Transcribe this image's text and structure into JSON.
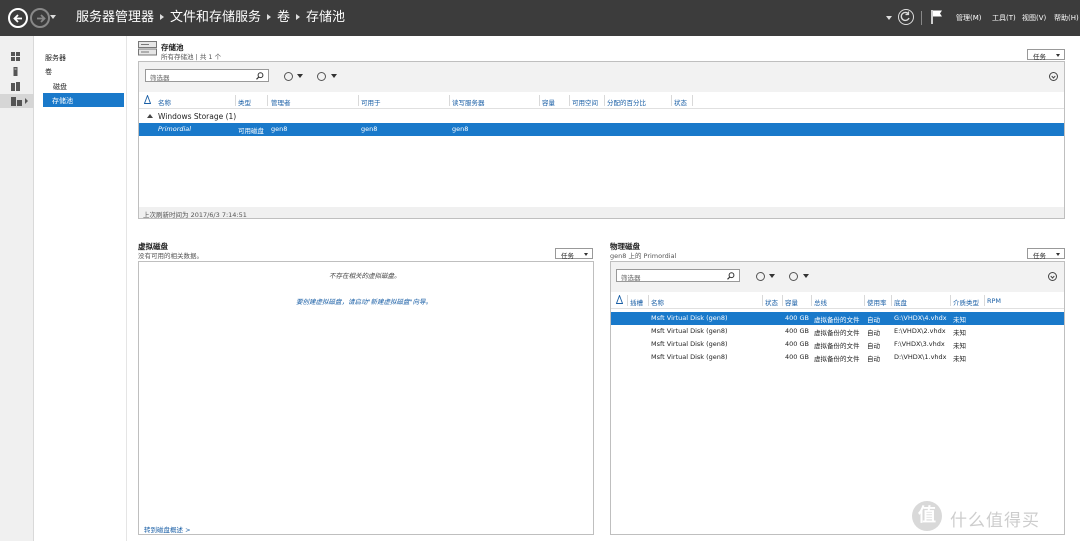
{
  "titlebar": {
    "breadcrumb": [
      "服务器管理器",
      "文件和存储服务",
      "卷",
      "存储池"
    ],
    "menu": [
      "管理(M)",
      "工具(T)",
      "视图(V)",
      "帮助(H)"
    ]
  },
  "rail": {
    "icons": [
      "dashboard-icon",
      "server-icon",
      "all-servers-icon",
      "file-storage-icon"
    ]
  },
  "subnav": {
    "items": [
      "服务器",
      "卷",
      "磁盘",
      "存储池"
    ],
    "selected": "存储池"
  },
  "storage_pools": {
    "title": "存储池",
    "subtitle": "所有存储池 | 共 1 个",
    "tasks_label": "任务",
    "filter_placeholder": "筛选器",
    "columns": [
      "名称",
      "类型",
      "管理者",
      "可用于",
      "读写服务器",
      "容量",
      "可用空间",
      "分配的百分比",
      "状态"
    ],
    "group": "Windows Storage (1)",
    "rows": [
      {
        "name": "Primordial",
        "type": "可用磁盘",
        "managed_by": "gen8",
        "available_to": "gen8",
        "rw_server": "gen8"
      }
    ],
    "status": "上次刷新时间为 2017/6/3 7:14:51"
  },
  "virtual_disks": {
    "title": "虚拟磁盘",
    "subtitle": "没有可用的相关数据。",
    "tasks_label": "任务",
    "empty_message": "不存在相关的虚拟磁盘。",
    "hint_message": "要创建虚拟磁盘，请启动\"新建虚拟磁盘\"向导。",
    "footer_link": "转到磁盘概述 >"
  },
  "physical_disks": {
    "title": "物理磁盘",
    "subtitle": "gen8 上的 Primordial",
    "tasks_label": "任务",
    "filter_placeholder": "筛选器",
    "columns": [
      "插槽",
      "名称",
      "状态",
      "容量",
      "总线",
      "使用率",
      "底盘",
      "介质类型",
      "RPM"
    ],
    "rows": [
      {
        "name": "Msft Virtual Disk (gen8)",
        "capacity": "400 GB",
        "bus": "虚拟备份的文件",
        "usage": "自动",
        "chassis": "G:\\VHDX\\4.vhdx",
        "media": "未知"
      },
      {
        "name": "Msft Virtual Disk (gen8)",
        "capacity": "400 GB",
        "bus": "虚拟备份的文件",
        "usage": "自动",
        "chassis": "E:\\VHDX\\2.vhdx",
        "media": "未知"
      },
      {
        "name": "Msft Virtual Disk (gen8)",
        "capacity": "400 GB",
        "bus": "虚拟备份的文件",
        "usage": "自动",
        "chassis": "F:\\VHDX\\3.vhdx",
        "media": "未知"
      },
      {
        "name": "Msft Virtual Disk (gen8)",
        "capacity": "400 GB",
        "bus": "虚拟备份的文件",
        "usage": "自动",
        "chassis": "D:\\VHDX\\1.vhdx",
        "media": "未知"
      }
    ]
  },
  "watermark": {
    "logo": "值",
    "text": "什么值得买"
  },
  "colors": {
    "titlebar": "#3c3c3c",
    "selection": "#1979ca",
    "link": "#1a5fa6"
  }
}
